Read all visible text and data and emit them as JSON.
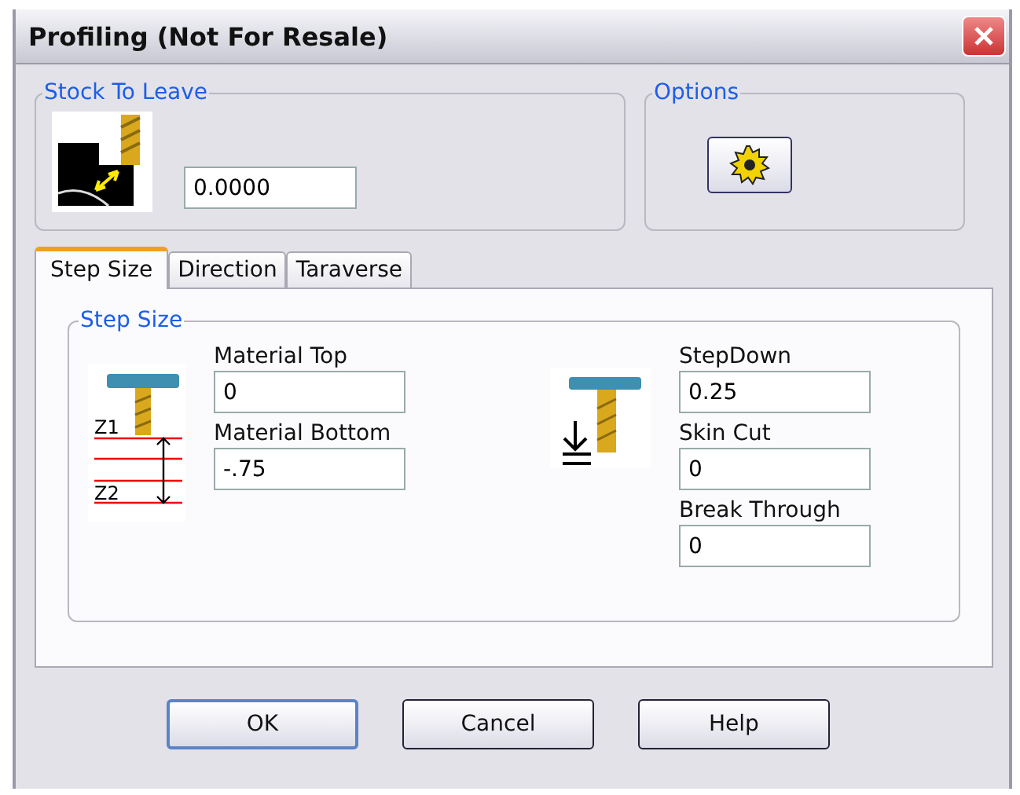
{
  "window": {
    "title": "Profiling (Not For Resale)"
  },
  "stock_to_leave": {
    "title": "Stock To Leave",
    "value": "0.0000"
  },
  "options": {
    "title": "Options"
  },
  "tabs": [
    {
      "label": "Step Size",
      "selected": true
    },
    {
      "label": "Direction",
      "selected": false
    },
    {
      "label": "Taraverse",
      "selected": false
    }
  ],
  "step_size": {
    "title": "Step Size",
    "diagram_labels": [
      "Z1",
      "Z2"
    ],
    "left_fields": [
      {
        "label": "Material Top",
        "value": "0"
      },
      {
        "label": "Material Bottom",
        "value": "-.75"
      }
    ],
    "right_fields": [
      {
        "label": "StepDown",
        "value": "0.25"
      },
      {
        "label": "Skin Cut",
        "value": "0"
      },
      {
        "label": "Break Through",
        "value": "0"
      }
    ]
  },
  "buttons": [
    {
      "label": "OK",
      "default": true
    },
    {
      "label": "Cancel",
      "default": false
    },
    {
      "label": "Help",
      "default": false
    }
  ]
}
